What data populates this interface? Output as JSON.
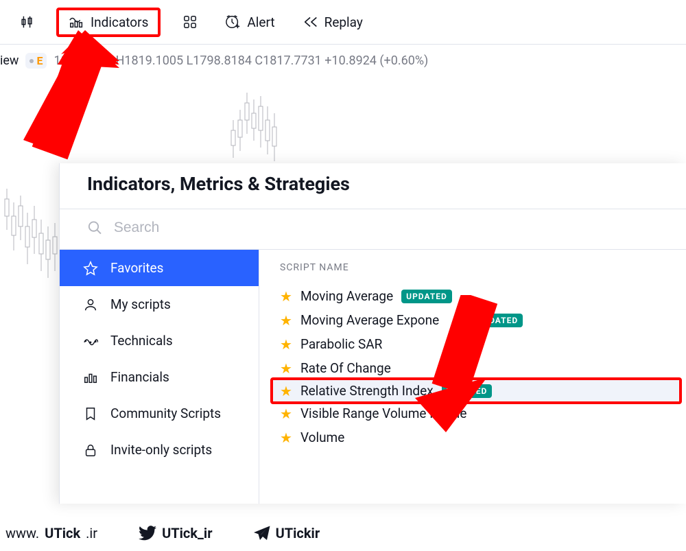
{
  "toolbar": {
    "indicators": "Indicators",
    "alert": "Alert",
    "replay": "Replay"
  },
  "status": {
    "view": "iew",
    "pill_letter": "E",
    "ohlc": "1810.9521 H1819.1005 L1798.8184 C1817.7731 +10.8924 (+0.60%)"
  },
  "modal": {
    "title": "Indicators, Metrics & Strategies",
    "search_placeholder": "Search",
    "categories": {
      "favorites": "Favorites",
      "my_scripts": "My scripts",
      "technicals": "Technicals",
      "financials": "Financials",
      "community": "Community Scripts",
      "invite_only": "Invite-only scripts"
    },
    "list_header": "SCRIPT NAME",
    "updated_label": "UPDATED",
    "items": [
      {
        "name": "Moving Average",
        "updated": true
      },
      {
        "name": "Moving Average Exponential",
        "updated": true,
        "obscured": true
      },
      {
        "name": "Parabolic SAR",
        "updated": false
      },
      {
        "name": "Rate Of Change",
        "updated": false
      },
      {
        "name": "Relative Strength Index",
        "updated": true,
        "highlight": true
      },
      {
        "name": "Visible Range Volume Profile",
        "updated": false
      },
      {
        "name": "Volume",
        "updated": false
      }
    ]
  },
  "footer": {
    "site_pre": "www.",
    "site_bold": "UTick",
    "site_suf": ".ir",
    "twitter": "UTick_ir",
    "telegram": "UTickir"
  }
}
